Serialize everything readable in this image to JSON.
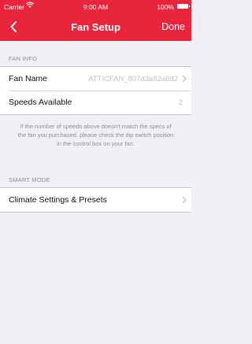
{
  "status_bar": {
    "carrier": "Carrier",
    "time": "9:00 AM",
    "battery": "100%"
  },
  "nav": {
    "title": "Fan Setup",
    "done_label": "Done",
    "back_icon": "chevron-left-icon"
  },
  "fan_info": {
    "header": "FAN INFO",
    "rows": [
      {
        "label": "Fan Name",
        "value": "ATTICFAN_807d3a82a6d2"
      },
      {
        "label": "Speeds Available",
        "value": "2"
      }
    ],
    "note": "If the number of speeds above doesn't match the specs of the fan you purchased, please check the dip switch position in the control box on your fan."
  },
  "smart_mode": {
    "header": "SMART MODE",
    "rows": [
      {
        "label": "Climate Settings & Presets"
      }
    ]
  },
  "colors": {
    "accent": "#e8253a",
    "background": "#efeff4"
  }
}
